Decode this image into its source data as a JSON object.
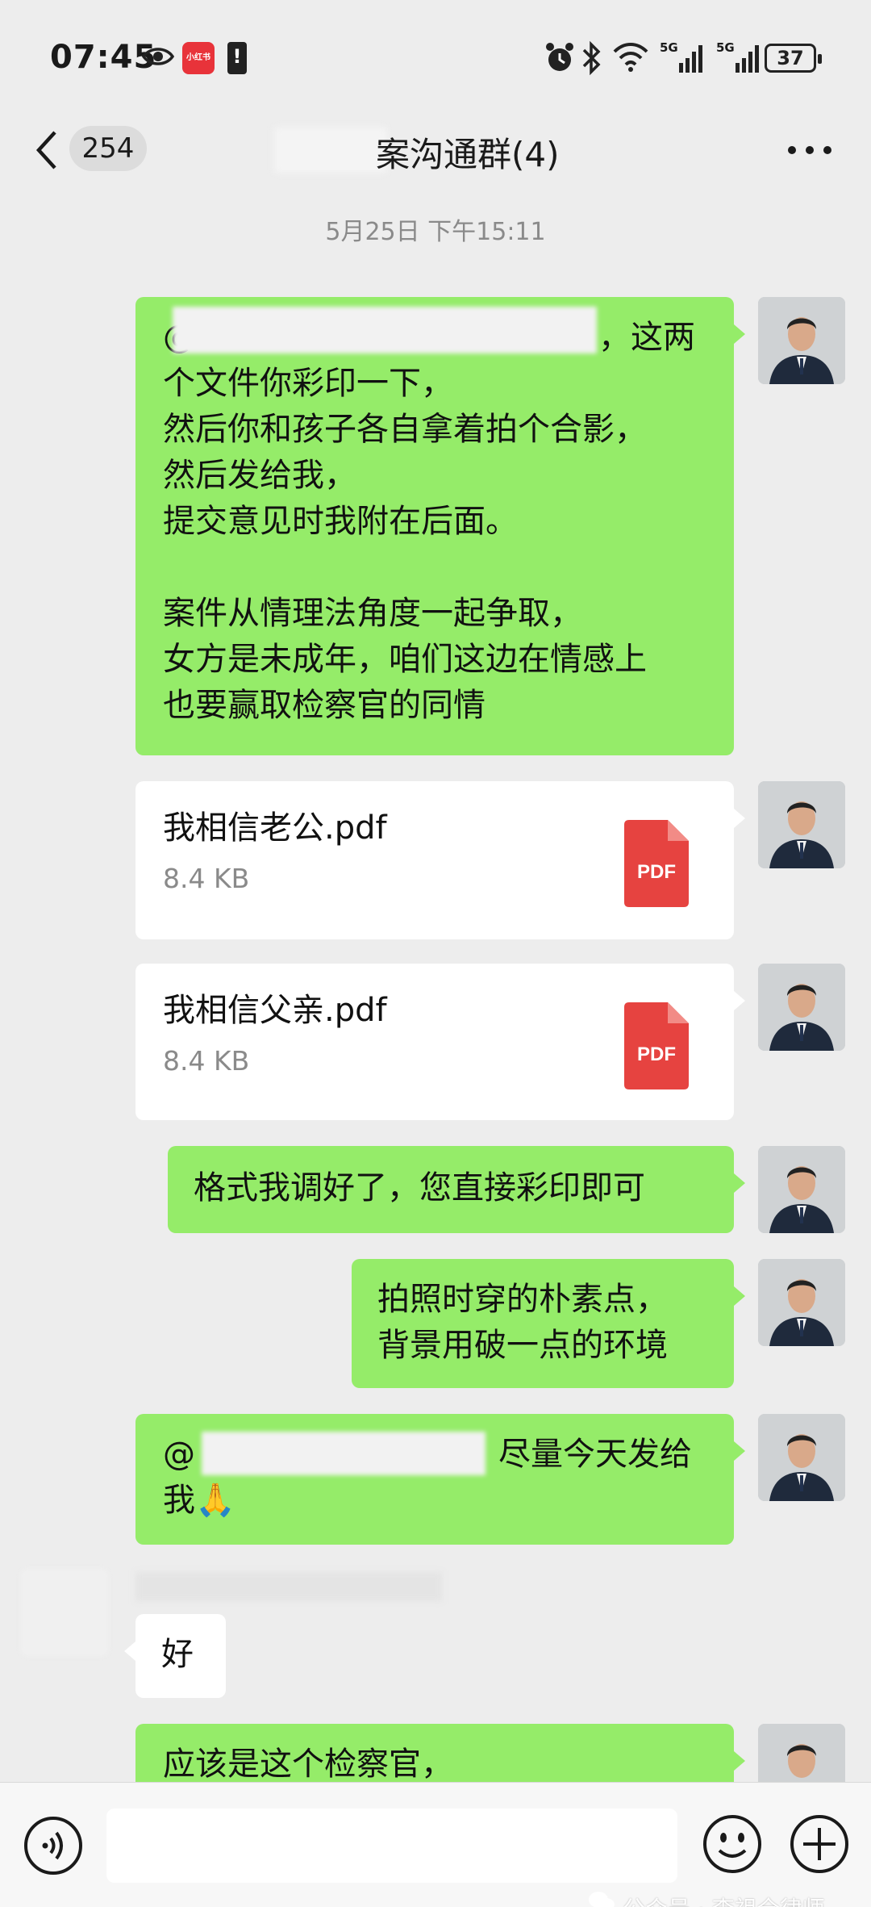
{
  "status_bar": {
    "time": "07:45",
    "app_badge": "小红书",
    "network_1": "5G",
    "network_2": "5G",
    "battery": "37"
  },
  "header": {
    "unread_count": "254",
    "title": "案沟通群(4)"
  },
  "timestamp": "5月25日 下午15:11",
  "messages": [
    {
      "side": "right",
      "type": "text",
      "lines": [
        "@",
        "，这两",
        "个文件你彩印一下，",
        "然后你和孩子各自拿着拍个合影，",
        "然后发给我，",
        "提交意见时我附在后面。",
        "",
        "案件从情理法角度一起争取，",
        "女方是未成年，咱们这边在情感上",
        "也要赢取检察官的同情"
      ]
    },
    {
      "side": "right",
      "type": "file",
      "file_name": "我相信老公.pdf",
      "file_size": "8.4 KB",
      "file_icon": "PDF"
    },
    {
      "side": "right",
      "type": "file",
      "file_name": "我相信父亲.pdf",
      "file_size": "8.4 KB",
      "file_icon": "PDF"
    },
    {
      "side": "right",
      "type": "text",
      "lines": [
        "格式我调好了，您直接彩印即可"
      ]
    },
    {
      "side": "right",
      "type": "text",
      "lines": [
        "拍照时穿的朴素点，",
        "背景用破一点的环境"
      ]
    },
    {
      "side": "right",
      "type": "text",
      "lines": [
        "@",
        "尽量今天发给",
        "我🙏"
      ]
    },
    {
      "side": "left",
      "type": "text",
      "lines": [
        "好"
      ]
    },
    {
      "side": "right",
      "type": "text",
      "lines": [
        "应该是这个检察官，"
      ]
    }
  ],
  "input_bar": {
    "placeholder": ""
  },
  "watermark": "公众号 · 李祖全律师",
  "colors": {
    "background": "#ededed",
    "bubble_self": "#95ec69",
    "bubble_other": "#ffffff",
    "pdf_red": "#e64340"
  },
  "icons": [
    "eye-icon",
    "alarm-icon",
    "bluetooth-icon",
    "wifi-icon",
    "signal-icon",
    "back-icon",
    "more-icon",
    "voice-icon",
    "emoji-icon",
    "plus-icon",
    "pdf-icon"
  ]
}
